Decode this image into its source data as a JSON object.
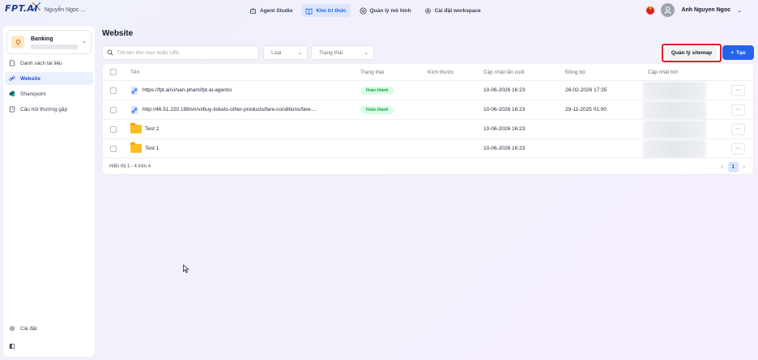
{
  "header": {
    "logo_text": "FPT.AI",
    "org_name": "Nguyễn Ngọc ...",
    "nav": [
      {
        "label": "Agent Studio",
        "icon": "robot-icon"
      },
      {
        "label": "Kho tri thức",
        "icon": "book-icon",
        "active": true
      },
      {
        "label": "Quản lý mô hình",
        "icon": "model-icon"
      },
      {
        "label": "Cài đặt workspace",
        "icon": "gear-icon"
      }
    ],
    "user_name": "Anh Nguyen Ngoc"
  },
  "sidebar": {
    "kb_name": "Banking",
    "items": [
      {
        "label": "Danh sách tài liệu",
        "icon": "document-icon"
      },
      {
        "label": "Website",
        "icon": "link-icon",
        "active": true
      },
      {
        "label": "Sharepoint",
        "icon": "sharepoint-icon"
      },
      {
        "label": "Câu hỏi thường gặp",
        "icon": "faq-icon"
      }
    ],
    "settings_label": "Cài đặt"
  },
  "main": {
    "title": "Website",
    "search_placeholder": "Tìm tên thư mục hoặc URL",
    "filter_type": "Loại",
    "filter_status": "Trạng thái",
    "sitemap_button": "Quản lý sitemap",
    "create_button": "Tạo",
    "columns": [
      "Tên",
      "Trạng thái",
      "Kích thước",
      "Cập nhật lần cuối",
      "Đồng bộ",
      "Cập nhật bởi"
    ],
    "rows": [
      {
        "name": "https://fpt.ai/vi/san-pham/fpt-ai-agents/",
        "kind": "link",
        "status": "Hoàn thành",
        "size": "",
        "updated": "10-06-2026 16:23",
        "synced": "26-02-2026 17:35"
      },
      {
        "name": "http://46.51.220.198/vn/vi/buy-tickets-other-products/fare-conditions/fare-...",
        "kind": "link",
        "status": "Hoàn thành",
        "size": "",
        "updated": "10-06-2026 16:23",
        "synced": "29-11-2025 01:00"
      },
      {
        "name": "Test 2",
        "kind": "folder",
        "status": "",
        "size": "",
        "updated": "10-06-2026 16:23",
        "synced": ""
      },
      {
        "name": "Test 1",
        "kind": "folder",
        "status": "",
        "size": "",
        "updated": "10-06-2026 16:23",
        "synced": ""
      }
    ],
    "footer_text": "Hiển thị 1 - 4 trên 4",
    "current_page": "1",
    "more_label": "···"
  }
}
